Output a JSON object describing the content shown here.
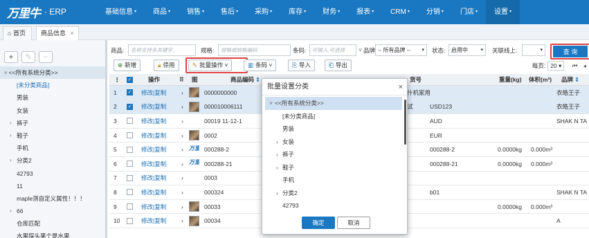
{
  "app": {
    "logo_mark": "万里牛",
    "logo_text": "ERP"
  },
  "nav": [
    {
      "label": "基础信息",
      "active": false
    },
    {
      "label": "商品",
      "active": false
    },
    {
      "label": "销售",
      "active": false
    },
    {
      "label": "售后",
      "active": false
    },
    {
      "label": "采购",
      "active": false
    },
    {
      "label": "库存",
      "active": false
    },
    {
      "label": "财务",
      "active": false
    },
    {
      "label": "报表",
      "active": false
    },
    {
      "label": "CRM",
      "active": false
    },
    {
      "label": "分销",
      "active": false
    },
    {
      "label": "门店",
      "active": false
    },
    {
      "label": "设置",
      "active": true
    }
  ],
  "tabs": {
    "home": "首页",
    "goods": "商品信息",
    "close": "×"
  },
  "sidebar": {
    "tools": {
      "add": "+",
      "edit": "✎",
      "remove": "−"
    },
    "items": [
      {
        "label": "<<所有系统分类>>",
        "root": true,
        "arrow": "˅"
      },
      {
        "label": "[未分类商品]",
        "link": true
      },
      {
        "label": "男装"
      },
      {
        "label": "女装"
      },
      {
        "label": "裤子",
        "arrow": "›"
      },
      {
        "label": "鞋子",
        "arrow": "›"
      },
      {
        "label": "手机"
      },
      {
        "label": "分类2",
        "arrow": "›"
      },
      {
        "label": "42793"
      },
      {
        "label": "11"
      },
      {
        "label": "maple测自定义属性！！！"
      },
      {
        "label": "66",
        "arrow": "›"
      },
      {
        "label": "仓库匹配"
      },
      {
        "label": "水果探头果个是水果"
      }
    ]
  },
  "filter": {
    "goods_label": "商品:",
    "goods_placeholder": "名称支持多关键字...",
    "spec_label": "规格:",
    "spec_placeholder": "规格或规格编码",
    "barcode_label": "条码:",
    "barcode_placeholder": "可输入,可选择",
    "brand_label": "品牌:",
    "brand_value": "-- 所有品牌 --",
    "status_label": "状态:",
    "status_value": "启用中",
    "link_label": "关联线上:",
    "link_value": "",
    "query": "查 询"
  },
  "toolbar": {
    "add": "新增",
    "disable": "停用",
    "batch": "批量操作",
    "barcode": "条码",
    "import": "导入",
    "export": "导出",
    "per_page_label": "每页:",
    "per_page": "20"
  },
  "grid": {
    "headers": {
      "ops": "操作",
      "img": "图",
      "code": "商品编码",
      "sku": "货号",
      "weight": "重量(kg)",
      "volume": "体积(m³)",
      "brand": "品牌"
    },
    "op_edit": "修改",
    "op_copy": "复制",
    "rows": [
      {
        "n": "1",
        "checked": true,
        "img": "photo",
        "code": "0000000000",
        "name": "什机家用",
        "sku": "",
        "weight": "",
        "volume": "",
        "brand": "衣皓王子",
        "sel": true
      },
      {
        "n": "2",
        "checked": true,
        "img": "photo",
        "code": "000010006111",
        "name": "试",
        "sku": "USD123",
        "weight": "",
        "volume": "",
        "brand": "衣皓王子",
        "sel": true
      },
      {
        "n": "3",
        "checked": false,
        "img": "",
        "code": "00019 11-12-1",
        "name": "",
        "sku": "AUD",
        "weight": "",
        "volume": "",
        "brand": "SHAK N TA"
      },
      {
        "n": "4",
        "checked": false,
        "img": "photo",
        "code": "0002",
        "name": "",
        "sku": "EUR",
        "weight": "",
        "volume": "",
        "brand": ""
      },
      {
        "n": "5",
        "checked": false,
        "img": "logo",
        "code": "000288-2",
        "name": "",
        "sku": "000288-2",
        "weight": "0.0000kg",
        "volume": "0.000m³",
        "brand": ""
      },
      {
        "n": "6",
        "checked": false,
        "img": "logo",
        "code": "000288-21",
        "name": "",
        "sku": "000288-21",
        "weight": "0.0000kg",
        "volume": "0.000m³",
        "brand": ""
      },
      {
        "n": "7",
        "checked": false,
        "img": "",
        "code": "0003",
        "name": "",
        "sku": "",
        "weight": "",
        "volume": "",
        "brand": ""
      },
      {
        "n": "8",
        "checked": false,
        "img": "",
        "code": "000324",
        "name": "",
        "sku": "b01",
        "weight": "",
        "volume": "",
        "brand": "SHAK N TA"
      },
      {
        "n": "9",
        "checked": false,
        "img": "photo",
        "code": "00033",
        "name": "",
        "sku": "",
        "weight": "0.0000kg",
        "volume": "0.000m³",
        "brand": ""
      },
      {
        "n": "10",
        "checked": false,
        "img": "photo",
        "code": "00034",
        "name": "",
        "sku": "",
        "weight": "",
        "volume": "",
        "brand": "A"
      }
    ]
  },
  "modal": {
    "title": "批量设置分类",
    "close": "×",
    "items": [
      {
        "label": "<<所有系统分类>>",
        "root": true,
        "arrow": "˅"
      },
      {
        "label": "[未分类商品]"
      },
      {
        "label": "男装"
      },
      {
        "label": "女装",
        "arrow": "›"
      },
      {
        "label": "裤子",
        "arrow": "›"
      },
      {
        "label": "鞋子",
        "arrow": "›"
      },
      {
        "label": "手机"
      },
      {
        "label": "分类2",
        "arrow": "›"
      },
      {
        "label": "42793"
      }
    ],
    "ok": "确定",
    "cancel": "取消"
  },
  "colors": {
    "nav_bg": "#1a78c2",
    "highlight_red": "#e04040",
    "selection_bg": "#dde9f5"
  }
}
